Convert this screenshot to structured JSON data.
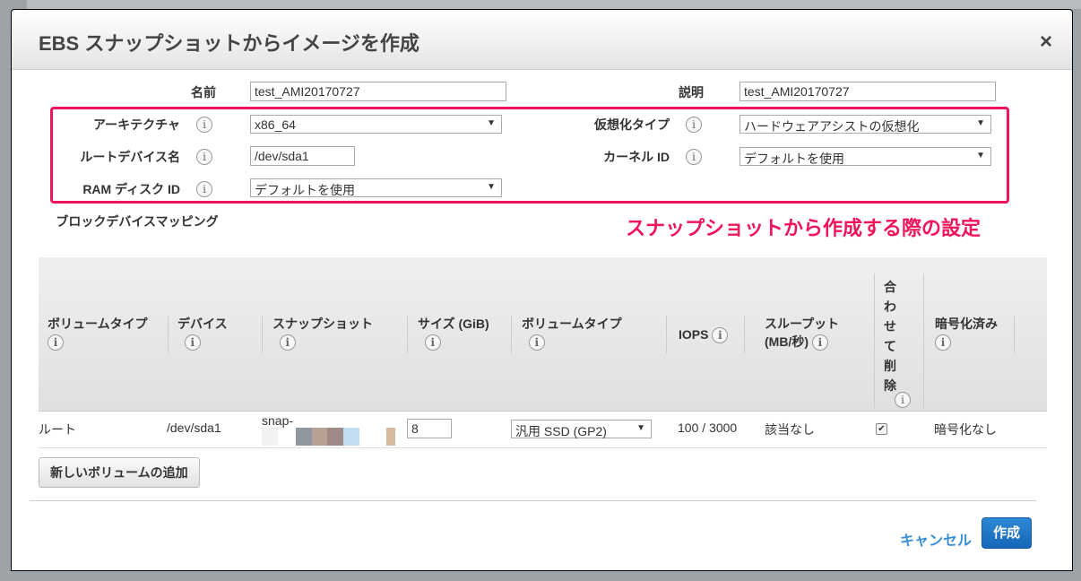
{
  "dialog": {
    "title": "EBS スナップショットからイメージを作成",
    "close_label": "×"
  },
  "form": {
    "name_label": "名前",
    "name_value": "test_AMI20170727",
    "desc_label": "説明",
    "desc_value": "test_AMI20170727",
    "arch_label": "アーキテクチャ",
    "arch_value": "x86_64",
    "virt_label": "仮想化タイプ",
    "virt_value": "ハードウェアアシストの仮想化",
    "root_label": "ルートデバイス名",
    "root_value": "/dev/sda1",
    "kernel_label": "カーネル ID",
    "kernel_value": "デフォルトを使用",
    "ram_label": "RAM ディスク ID",
    "ram_value": "デフォルトを使用",
    "bdm_label": "ブロックデバイスマッピング"
  },
  "annotation": "スナップショットから作成する際の設定",
  "table": {
    "headers": [
      "ボリュームタイプ",
      "デバイス",
      "スナップショット",
      "サイズ (GiB)",
      "ボリュームタイプ",
      "IOPS",
      "スループット (MB/秒)",
      "合わせて削除",
      "暗号化済み"
    ],
    "row": {
      "type": "ルート",
      "device": "/dev/sda1",
      "snapshot": "snap-",
      "size": "8",
      "volume_type": "汎用 SSD (GP2)",
      "iops": "100 / 3000",
      "throughput": "該当なし",
      "delete_on_termination": true,
      "encrypted": "暗号化なし"
    }
  },
  "buttons": {
    "add_volume": "新しいボリュームの追加",
    "cancel": "キャンセル",
    "create": "作成"
  },
  "colors": {
    "highlight": "#f0145a",
    "primary": "#1a73c6"
  }
}
